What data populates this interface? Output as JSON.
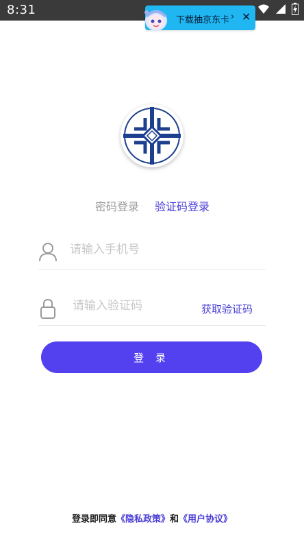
{
  "status_bar": {
    "time": "8:31"
  },
  "promo": {
    "text": "下载抽京东卡",
    "chevron": "›",
    "close": "✕",
    "mascot_icon": "mascot-avatar-icon"
  },
  "logo": {
    "icon": "china-railway-construction-logo"
  },
  "tabs": {
    "password_login": "密码登录",
    "code_login": "验证码登录"
  },
  "form": {
    "phone_placeholder": "请输入手机号",
    "phone_value": "",
    "code_placeholder": "请输入验证码",
    "code_value": "",
    "get_code": "获取验证码",
    "user_icon": "user-icon",
    "lock_icon": "lock-icon"
  },
  "login_button": {
    "label": "登 录"
  },
  "agreement": {
    "prefix": "登录即同意",
    "privacy": "《隐私政策》",
    "and": "和",
    "terms": "《用户协议》"
  },
  "colors": {
    "accent": "#5341ef",
    "link": "#4a3fd6",
    "status_bar": "#3a3a3a",
    "promo_bg": "#1fb6f2",
    "logo_blue": "#1d3f8f"
  }
}
